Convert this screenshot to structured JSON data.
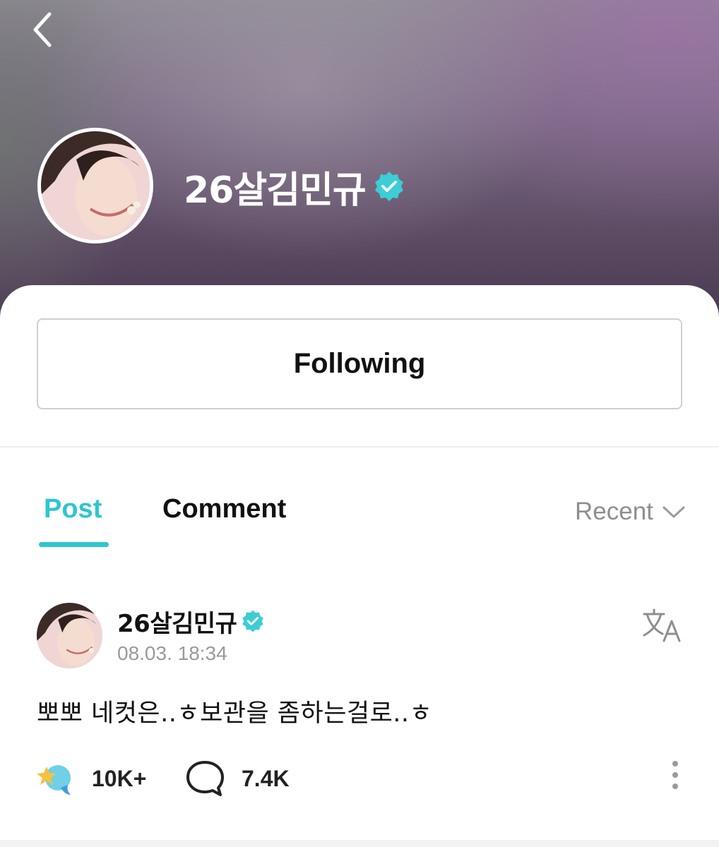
{
  "profile": {
    "name": "26살김민규",
    "verified": true,
    "follow_button_label": "Following"
  },
  "tabs": [
    {
      "label": "Post",
      "active": true
    },
    {
      "label": "Comment",
      "active": false
    }
  ],
  "sort": {
    "label": "Recent"
  },
  "post": {
    "author": "26살김민규",
    "verified": true,
    "timestamp": "08.03. 18:34",
    "text": "뽀뽀 네컷은..ㅎ보관을 좀하는걸로..ㅎ",
    "likes": "10K+",
    "comments": "7.4K"
  },
  "colors": {
    "accent": "#2ec6cf",
    "verified_badge": "#3ccdd5",
    "muted_text": "#9a9a9a"
  },
  "icons": [
    "back-arrow-icon",
    "verified-badge-icon",
    "chevron-down-icon",
    "translate-icon",
    "star-bubble-icon",
    "speech-bubble-icon",
    "more-vertical-icon"
  ]
}
